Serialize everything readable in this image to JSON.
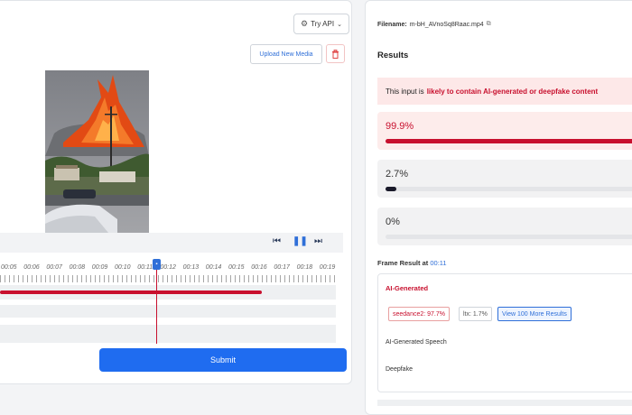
{
  "left": {
    "try_api_label": "Try API",
    "upload_label": "Upload New Media",
    "timeline_labels": [
      "00:05",
      "00:06",
      "00:07",
      "00:08",
      "00:09",
      "00:10",
      "00:11",
      "00:12",
      "00:13",
      "00:14",
      "00:15",
      "00:16",
      "00:17",
      "00:18",
      "00:19"
    ],
    "submit_label": "Submit",
    "detection_coverage": 0.78,
    "playhead_time": "00:11"
  },
  "right": {
    "filename_label": "Filename:",
    "filename": "m-bH_AVnoSq8Raac.mp4",
    "results_title": "Results",
    "verdict_prefix": "This input is",
    "verdict_highlight": "likely to contain AI-generated or deepfake content",
    "scores": [
      {
        "label": "99.9%",
        "value": 0.999,
        "hot": true
      },
      {
        "label": "2.7%",
        "value": 0.027,
        "hot": false
      },
      {
        "label": "0%",
        "value": 0.0,
        "hot": false
      }
    ],
    "frame_result_label": "Frame Result at",
    "frame_result_time": "00:11",
    "ai_generated_label": "AI-Generated",
    "chips": [
      "seedance2: 97.7%",
      "ltx: 1.7%",
      "View 100 More Results"
    ],
    "speech_label": "AI-Generated Speech",
    "deepfake_label": "Deepfake"
  },
  "colors": {
    "accent_red": "#c8102e",
    "accent_blue": "#1f6cf0"
  }
}
